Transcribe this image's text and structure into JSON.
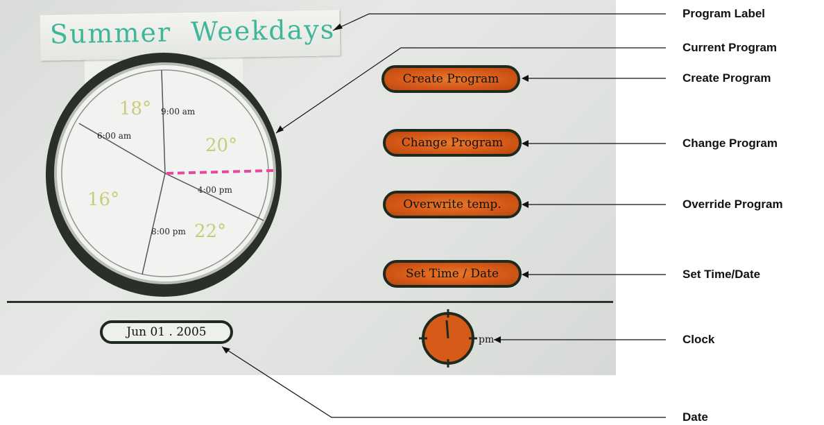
{
  "mockup": {
    "program_label_text": "Summer  Weekdays",
    "dial": {
      "time_labels": [
        "9:00 am",
        "6:00 am",
        "4:00 pm",
        "8:00 pm"
      ],
      "temperatures": [
        "18°",
        "20°",
        "16°",
        "22°"
      ]
    },
    "buttons": {
      "create": "Create Program",
      "change": "Change Program",
      "overwrite": "Overwrite temp.",
      "set_time": "Set Time / Date"
    },
    "date": "Jun 01 . 2005",
    "am_pm": "pm"
  },
  "callouts": {
    "program_label": "Program Label",
    "current_program": "Current Program",
    "create_program": "Create Program",
    "change_program": "Change Program",
    "override_program": "Override Program",
    "set_time_date": "Set Time/Date",
    "clock": "Clock",
    "date": "Date"
  },
  "colors": {
    "button_fill": "#d65a18",
    "label_ink": "#3fb59a",
    "current_time_marker": "#e8479a",
    "temperature_ink": "#c9cc7a"
  }
}
